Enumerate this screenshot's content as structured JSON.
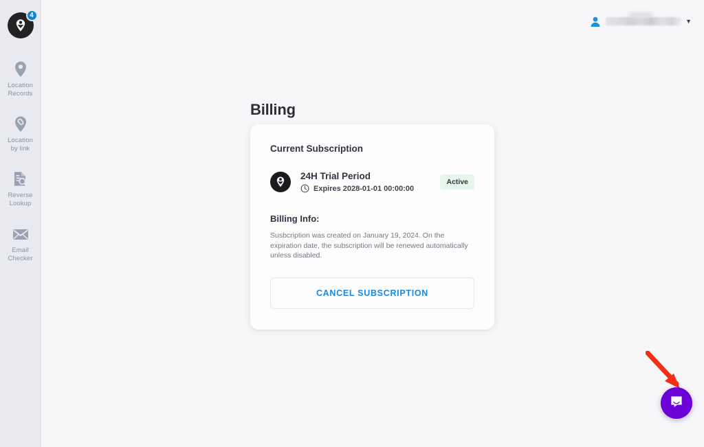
{
  "sidebar": {
    "brand": {
      "icon": "person-pin-logo-icon",
      "badge_count": "4"
    },
    "items": [
      {
        "icon": "map-pin-icon",
        "label": "Location\nRecords",
        "label_line1": "Location",
        "label_line2": "Records"
      },
      {
        "icon": "pin-link-icon",
        "label": "Location\nby link",
        "label_line1": "Location",
        "label_line2": "by link"
      },
      {
        "icon": "document-search-icon",
        "label": "Reverse\nLookup",
        "label_line1": "Reverse",
        "label_line2": "Lookup"
      },
      {
        "icon": "envelope-icon",
        "label": "Email\nChecker",
        "label_line1": "Email",
        "label_line2": "Checker"
      }
    ]
  },
  "topbar": {
    "user_menu": {
      "avatar_icon": "user-avatar-icon",
      "username": "",
      "caret_icon": "chevron-down-icon"
    }
  },
  "main": {
    "page_title": "Billing",
    "card": {
      "title": "Current Subscription",
      "plan": {
        "logo_icon": "brand-pin-icon",
        "name": "24H Trial Period",
        "expiry_icon": "clock-icon",
        "expiry_text": "Expires 2028-01-01 00:00:00",
        "status": "Active"
      },
      "billing_info": {
        "title": "Billing Info:",
        "text": "Susbcription was created on January 19, 2024. On the expiration date, the subscription will be renewed automatically unless disabled."
      },
      "cancel_button": "CANCEL SUBSCRIPTION"
    }
  },
  "chat": {
    "icon": "chat-bubble-icon",
    "annotation_icon": "red-arrow-annotation"
  },
  "colors": {
    "page_background": "#f7f7f9",
    "sidebar_background": "#e8eaef",
    "card_background": "#fdfdfd",
    "brand_dark": "#232326",
    "badge_blue": "#1381d2",
    "link_blue": "#1a89e0",
    "status_green_bg": "#e6f6ec",
    "chat_purple": "#6b00d7",
    "annotation_red": "#f52d16",
    "nav_icon_gray": "#9aa1b1",
    "nav_label_gray": "#8b91a0"
  }
}
